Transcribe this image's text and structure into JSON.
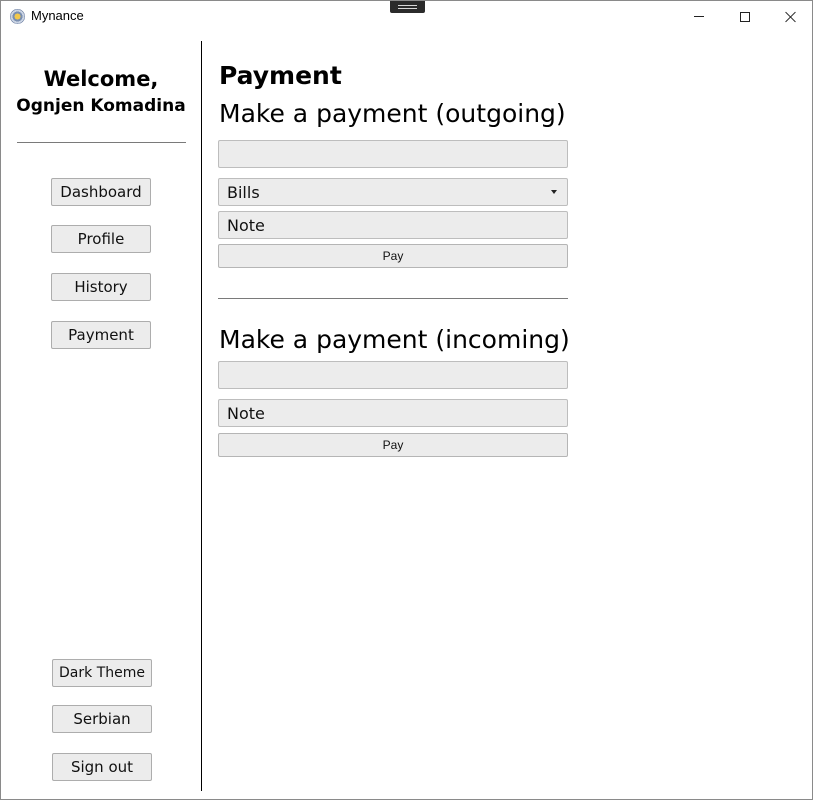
{
  "window": {
    "title": "Mynance",
    "icon": "mynance-logo-icon"
  },
  "sidebar": {
    "welcome": "Welcome,",
    "user_name": "Ognjen Komadina",
    "nav": {
      "dashboard": "Dashboard",
      "profile": "Profile",
      "history": "History",
      "payment": "Payment"
    },
    "footer": {
      "theme": "Dark Theme",
      "language": "Serbian",
      "sign_out": "Sign out"
    }
  },
  "main": {
    "page_title": "Payment",
    "outgoing": {
      "title": "Make a payment (outgoing)",
      "amount_value": "",
      "category_selected": "Bills",
      "note_value": "Note",
      "pay_label": "Pay"
    },
    "incoming": {
      "title": "Make a payment (incoming)",
      "amount_value": "",
      "note_value": "Note",
      "pay_label": "Pay"
    }
  },
  "colors": {
    "control_bg": "#ececec",
    "control_border": "#adadad",
    "divider": "#7a7a7a"
  }
}
